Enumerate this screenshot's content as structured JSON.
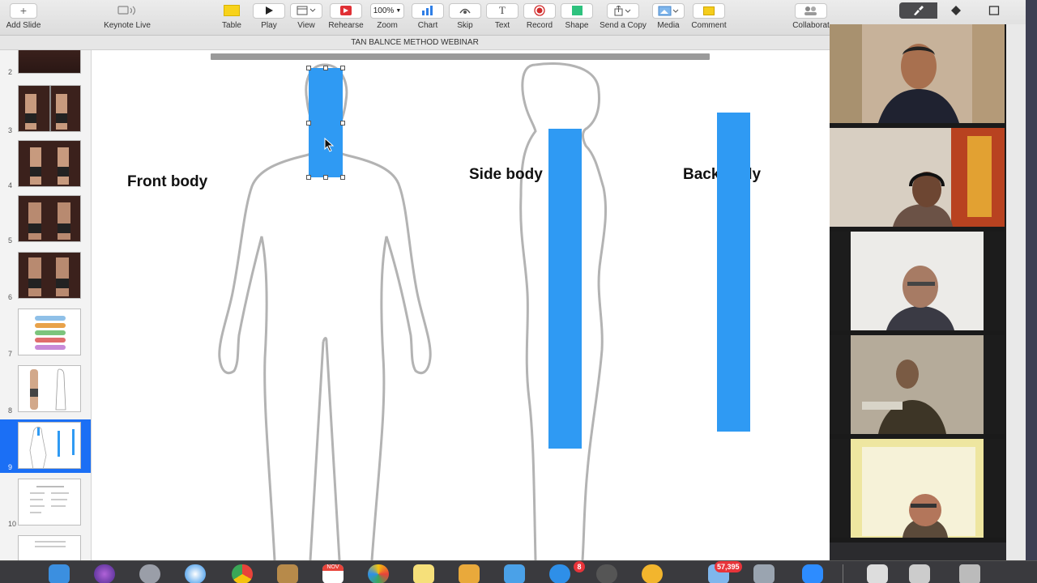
{
  "window": {
    "document_title": "TAN BALNCE METHOD WEBINAR"
  },
  "toolbar": {
    "add_slide": "Add Slide",
    "keynote_live": "Keynote Live",
    "table": "Table",
    "play": "Play",
    "view": "View",
    "rehearse": "Rehearse",
    "zoom_value": "100%",
    "zoom": "Zoom",
    "chart": "Chart",
    "skip": "Skip",
    "text": "Text",
    "record": "Record",
    "shape": "Shape",
    "send_a_copy": "Send a Copy",
    "media": "Media",
    "comment": "Comment",
    "collaborate": "Collaborat"
  },
  "navigator": {
    "selected_slide": 9,
    "slides": [
      {
        "number": "2"
      },
      {
        "number": "3"
      },
      {
        "number": "4"
      },
      {
        "number": "5"
      },
      {
        "number": "6"
      },
      {
        "number": "7"
      },
      {
        "number": "8"
      },
      {
        "number": "9"
      },
      {
        "number": "10"
      }
    ]
  },
  "slide": {
    "front_label": "Front body",
    "side_label": "Side body",
    "back_label": "Back body",
    "accent_color": "#2f9af3"
  },
  "dock": {
    "calendar_month": "NOV",
    "mail_badge": "57,395",
    "app_badge": "8"
  }
}
